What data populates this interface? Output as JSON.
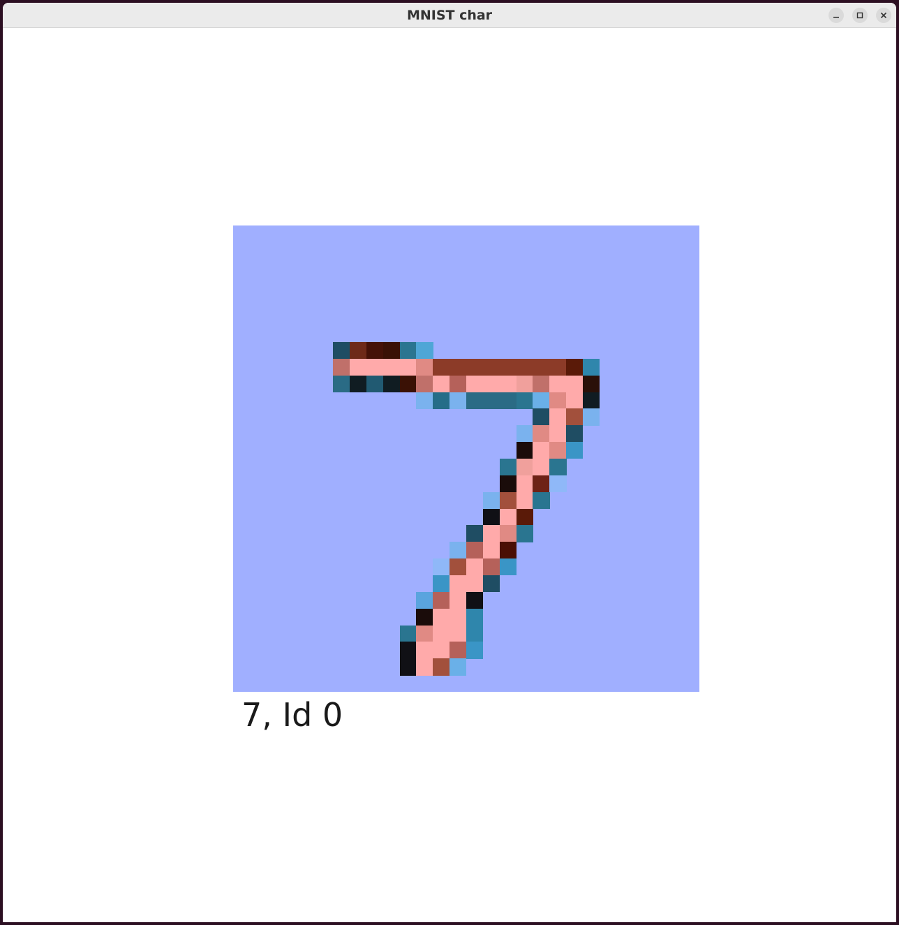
{
  "window": {
    "title": "MNIST char",
    "controls": {
      "minimize": "minimize-icon",
      "maximize": "maximize-icon",
      "close": "close-icon"
    }
  },
  "image": {
    "background_color": "#a0afff",
    "grid_size": 28,
    "pixels": [
      {
        "r": 7,
        "c": 6,
        "color": "#1f4d63"
      },
      {
        "r": 7,
        "c": 7,
        "color": "#6e2a18"
      },
      {
        "r": 7,
        "c": 8,
        "color": "#451207"
      },
      {
        "r": 7,
        "c": 9,
        "color": "#3a1105"
      },
      {
        "r": 7,
        "c": 10,
        "color": "#2a7590"
      },
      {
        "r": 7,
        "c": 11,
        "color": "#4fa6d6"
      },
      {
        "r": 8,
        "c": 6,
        "color": "#c0706a"
      },
      {
        "r": 8,
        "c": 7,
        "color": "#ffaaaa"
      },
      {
        "r": 8,
        "c": 8,
        "color": "#ffaaaa"
      },
      {
        "r": 8,
        "c": 9,
        "color": "#ffaaaa"
      },
      {
        "r": 8,
        "c": 10,
        "color": "#ffaaaa"
      },
      {
        "r": 8,
        "c": 11,
        "color": "#e08a84"
      },
      {
        "r": 8,
        "c": 12,
        "color": "#8c3b28"
      },
      {
        "r": 8,
        "c": 13,
        "color": "#8c3b28"
      },
      {
        "r": 8,
        "c": 14,
        "color": "#8c3b28"
      },
      {
        "r": 8,
        "c": 15,
        "color": "#8c3b28"
      },
      {
        "r": 8,
        "c": 16,
        "color": "#8c3b28"
      },
      {
        "r": 8,
        "c": 17,
        "color": "#8c3b28"
      },
      {
        "r": 8,
        "c": 18,
        "color": "#8c3b28"
      },
      {
        "r": 8,
        "c": 19,
        "color": "#8c3b28"
      },
      {
        "r": 8,
        "c": 20,
        "color": "#5a1a08"
      },
      {
        "r": 8,
        "c": 21,
        "color": "#2f86ac"
      },
      {
        "r": 9,
        "c": 6,
        "color": "#2a6b85"
      },
      {
        "r": 9,
        "c": 7,
        "color": "#101c22"
      },
      {
        "r": 9,
        "c": 8,
        "color": "#215a72"
      },
      {
        "r": 9,
        "c": 9,
        "color": "#101c22"
      },
      {
        "r": 9,
        "c": 10,
        "color": "#3a1105"
      },
      {
        "r": 9,
        "c": 11,
        "color": "#c0706a"
      },
      {
        "r": 9,
        "c": 12,
        "color": "#ffaaaa"
      },
      {
        "r": 9,
        "c": 13,
        "color": "#b5615a"
      },
      {
        "r": 9,
        "c": 14,
        "color": "#ffaaaa"
      },
      {
        "r": 9,
        "c": 15,
        "color": "#ffaaaa"
      },
      {
        "r": 9,
        "c": 16,
        "color": "#ffaaaa"
      },
      {
        "r": 9,
        "c": 17,
        "color": "#f0a09c"
      },
      {
        "r": 9,
        "c": 18,
        "color": "#c0706a"
      },
      {
        "r": 9,
        "c": 19,
        "color": "#ffaaaa"
      },
      {
        "r": 9,
        "c": 20,
        "color": "#ffaaaa"
      },
      {
        "r": 9,
        "c": 21,
        "color": "#2a1008"
      },
      {
        "r": 10,
        "c": 11,
        "color": "#7ab2ee"
      },
      {
        "r": 10,
        "c": 12,
        "color": "#256d88"
      },
      {
        "r": 10,
        "c": 13,
        "color": "#7ab2ee"
      },
      {
        "r": 10,
        "c": 14,
        "color": "#2a6b85"
      },
      {
        "r": 10,
        "c": 15,
        "color": "#2a6b85"
      },
      {
        "r": 10,
        "c": 16,
        "color": "#2a6b85"
      },
      {
        "r": 10,
        "c": 17,
        "color": "#2a7590"
      },
      {
        "r": 10,
        "c": 18,
        "color": "#6ab0e8"
      },
      {
        "r": 10,
        "c": 19,
        "color": "#e08a84"
      },
      {
        "r": 10,
        "c": 20,
        "color": "#ffaaaa"
      },
      {
        "r": 10,
        "c": 21,
        "color": "#101c22"
      },
      {
        "r": 11,
        "c": 18,
        "color": "#1f4d63"
      },
      {
        "r": 11,
        "c": 19,
        "color": "#ffaaaa"
      },
      {
        "r": 11,
        "c": 20,
        "color": "#a2503c"
      },
      {
        "r": 11,
        "c": 21,
        "color": "#7ab2ee"
      },
      {
        "r": 12,
        "c": 17,
        "color": "#7ab2ee"
      },
      {
        "r": 12,
        "c": 18,
        "color": "#e08a84"
      },
      {
        "r": 12,
        "c": 19,
        "color": "#ffaaaa"
      },
      {
        "r": 12,
        "c": 20,
        "color": "#1f4d63"
      },
      {
        "r": 13,
        "c": 17,
        "color": "#1a0c0a"
      },
      {
        "r": 13,
        "c": 18,
        "color": "#ffaaaa"
      },
      {
        "r": 13,
        "c": 19,
        "color": "#e08a84"
      },
      {
        "r": 13,
        "c": 20,
        "color": "#3a95c6"
      },
      {
        "r": 14,
        "c": 16,
        "color": "#2a7590"
      },
      {
        "r": 14,
        "c": 17,
        "color": "#f0a09c"
      },
      {
        "r": 14,
        "c": 18,
        "color": "#ffaaaa"
      },
      {
        "r": 14,
        "c": 19,
        "color": "#2a7590"
      },
      {
        "r": 15,
        "c": 16,
        "color": "#1a0c0a"
      },
      {
        "r": 15,
        "c": 17,
        "color": "#ffaaaa"
      },
      {
        "r": 15,
        "c": 18,
        "color": "#6e2216"
      },
      {
        "r": 15,
        "c": 19,
        "color": "#8fb8f8"
      },
      {
        "r": 16,
        "c": 15,
        "color": "#7ab2ee"
      },
      {
        "r": 16,
        "c": 16,
        "color": "#a2503c"
      },
      {
        "r": 16,
        "c": 17,
        "color": "#ffaaaa"
      },
      {
        "r": 16,
        "c": 18,
        "color": "#2a7590"
      },
      {
        "r": 17,
        "c": 15,
        "color": "#101015"
      },
      {
        "r": 17,
        "c": 16,
        "color": "#ffaaaa"
      },
      {
        "r": 17,
        "c": 17,
        "color": "#5a1a08"
      },
      {
        "r": 18,
        "c": 14,
        "color": "#1f4d63"
      },
      {
        "r": 18,
        "c": 15,
        "color": "#ffaaaa"
      },
      {
        "r": 18,
        "c": 16,
        "color": "#e08a84"
      },
      {
        "r": 18,
        "c": 17,
        "color": "#2a7590"
      },
      {
        "r": 19,
        "c": 13,
        "color": "#7ab2ee"
      },
      {
        "r": 19,
        "c": 14,
        "color": "#b5615a"
      },
      {
        "r": 19,
        "c": 15,
        "color": "#ffaaaa"
      },
      {
        "r": 19,
        "c": 16,
        "color": "#4a0f05"
      },
      {
        "r": 20,
        "c": 12,
        "color": "#8fb8f8"
      },
      {
        "r": 20,
        "c": 13,
        "color": "#a2503c"
      },
      {
        "r": 20,
        "c": 14,
        "color": "#ffaaaa"
      },
      {
        "r": 20,
        "c": 15,
        "color": "#b5615a"
      },
      {
        "r": 20,
        "c": 16,
        "color": "#3a95c6"
      },
      {
        "r": 21,
        "c": 12,
        "color": "#3a95c6"
      },
      {
        "r": 21,
        "c": 13,
        "color": "#ffaaaa"
      },
      {
        "r": 21,
        "c": 14,
        "color": "#ffaaaa"
      },
      {
        "r": 21,
        "c": 15,
        "color": "#1f4d63"
      },
      {
        "r": 22,
        "c": 11,
        "color": "#5aa4de"
      },
      {
        "r": 22,
        "c": 12,
        "color": "#b5615a"
      },
      {
        "r": 22,
        "c": 13,
        "color": "#ffaaaa"
      },
      {
        "r": 22,
        "c": 14,
        "color": "#101015"
      },
      {
        "r": 23,
        "c": 11,
        "color": "#1a0c0a"
      },
      {
        "r": 23,
        "c": 12,
        "color": "#ffaaaa"
      },
      {
        "r": 23,
        "c": 13,
        "color": "#ffaaaa"
      },
      {
        "r": 23,
        "c": 14,
        "color": "#2f86ac"
      },
      {
        "r": 24,
        "c": 10,
        "color": "#2a7590"
      },
      {
        "r": 24,
        "c": 11,
        "color": "#e08a84"
      },
      {
        "r": 24,
        "c": 12,
        "color": "#ffaaaa"
      },
      {
        "r": 24,
        "c": 13,
        "color": "#ffaaaa"
      },
      {
        "r": 24,
        "c": 14,
        "color": "#2f86ac"
      },
      {
        "r": 25,
        "c": 10,
        "color": "#101015"
      },
      {
        "r": 25,
        "c": 11,
        "color": "#ffaaaa"
      },
      {
        "r": 25,
        "c": 12,
        "color": "#ffaaaa"
      },
      {
        "r": 25,
        "c": 13,
        "color": "#b5615a"
      },
      {
        "r": 25,
        "c": 14,
        "color": "#3a95c6"
      },
      {
        "r": 26,
        "c": 10,
        "color": "#101015"
      },
      {
        "r": 26,
        "c": 11,
        "color": "#ffaaaa"
      },
      {
        "r": 26,
        "c": 12,
        "color": "#a2503c"
      },
      {
        "r": 26,
        "c": 13,
        "color": "#6ab0e8"
      }
    ]
  },
  "caption": "7, Id 0"
}
